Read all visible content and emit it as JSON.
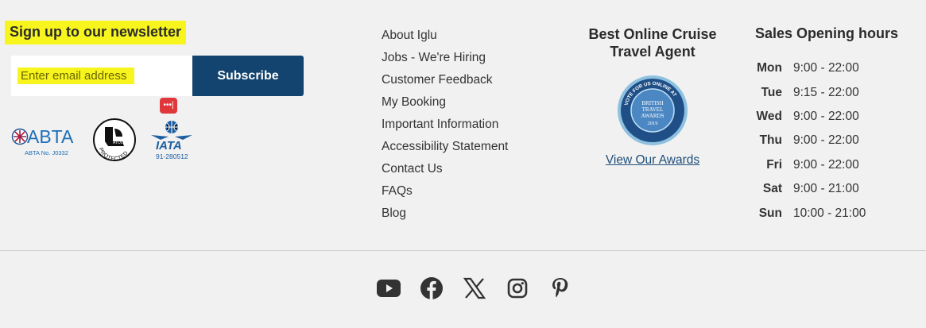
{
  "newsletter": {
    "title": "Sign up to our newsletter",
    "email_placeholder": "Enter email address",
    "subscribe_label": "Subscribe",
    "badge_text": "•••|"
  },
  "accreditation": {
    "abta_label": "ABTA",
    "abta_number": "ABTA No. J0332",
    "atol_label": "PROTECTED",
    "atol_brand": "ATOL",
    "iata_label": "IATA",
    "iata_number": "91-280512"
  },
  "footer_links": [
    "About Iglu",
    "Jobs - We're Hiring",
    "Customer Feedback",
    "My Booking",
    "Important Information",
    "Accessibility Statement",
    "Contact Us",
    "FAQs",
    "Blog"
  ],
  "awards": {
    "title_line1": "Best Online Cruise",
    "title_line2": "Travel Agent",
    "badge_top": "VOTE FOR US ONLINE AT",
    "badge_line1": "BRITISH",
    "badge_line2": "TRAVEL",
    "badge_line3": "AWARDS",
    "badge_year": "2019",
    "link_label": "View Our Awards"
  },
  "hours": {
    "title": "Sales Opening hours",
    "rows": [
      {
        "day": "Mon",
        "time": "9:00 - 22:00"
      },
      {
        "day": "Tue",
        "time": "9:15 - 22:00"
      },
      {
        "day": "Wed",
        "time": "9:00 - 22:00"
      },
      {
        "day": "Thu",
        "time": "9:00 - 22:00"
      },
      {
        "day": "Fri",
        "time": "9:00 - 22:00"
      },
      {
        "day": "Sat",
        "time": "9:00 - 21:00"
      },
      {
        "day": "Sun",
        "time": "10:00 - 21:00"
      }
    ]
  },
  "social_icons": [
    "youtube-icon",
    "facebook-icon",
    "x-twitter-icon",
    "instagram-icon",
    "pinterest-icon"
  ],
  "colors": {
    "background": "#f1f1f1",
    "subscribe_button": "#12446f",
    "highlight": "#f7f51d",
    "link": "#1e4e79",
    "social_icon": "#333333"
  }
}
